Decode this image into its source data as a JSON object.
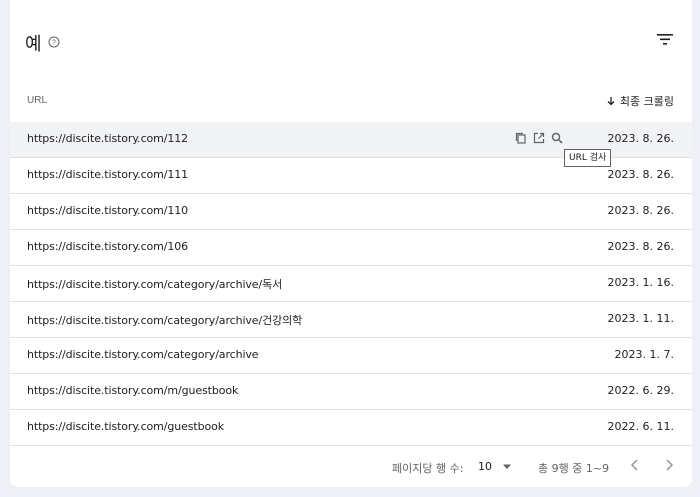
{
  "panel": {
    "title": "예"
  },
  "table": {
    "url_header": "URL",
    "sort_header": "최종 크롤링",
    "rows": [
      {
        "url": "https://discite.tistory.com/112",
        "date": "2023. 8. 26."
      },
      {
        "url": "https://discite.tistory.com/111",
        "date": "2023. 8. 26."
      },
      {
        "url": "https://discite.tistory.com/110",
        "date": "2023. 8. 26."
      },
      {
        "url": "https://discite.tistory.com/106",
        "date": "2023. 8. 26."
      },
      {
        "url": "https://discite.tistory.com/category/archive/독서",
        "date": "2023. 1. 16."
      },
      {
        "url": "https://discite.tistory.com/category/archive/건강의학",
        "date": "2023. 1. 11."
      },
      {
        "url": "https://discite.tistory.com/category/archive",
        "date": "2023. 1. 7."
      },
      {
        "url": "https://discite.tistory.com/m/guestbook",
        "date": "2022. 6. 29."
      },
      {
        "url": "https://discite.tistory.com/guestbook",
        "date": "2022. 6. 11."
      }
    ]
  },
  "tooltip": "URL 검사",
  "pagination": {
    "rows_per_page_label": "페이지당 행 수:",
    "rows_per_page_value": "10",
    "range_label": "총 9행 중 1~9"
  },
  "icons": {
    "help": "help-circle-icon",
    "filter": "filter-icon",
    "sort": "arrow-down-icon",
    "copy": "copy-icon",
    "open": "open-in-new-icon",
    "inspect": "search-icon"
  }
}
